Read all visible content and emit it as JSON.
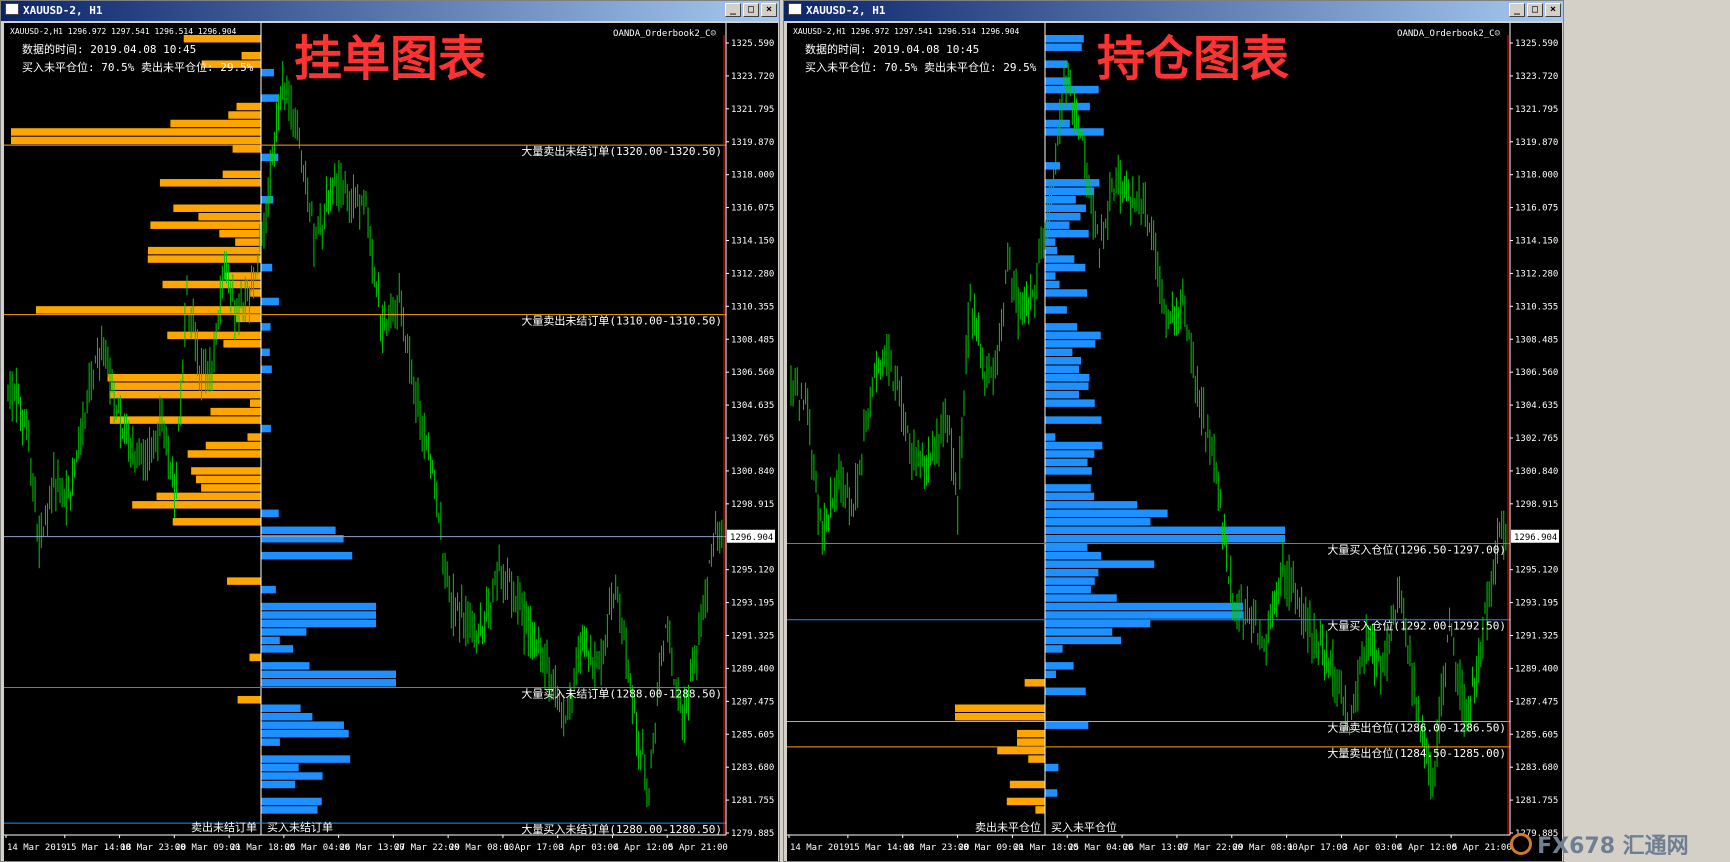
{
  "watermark": {
    "text": "FX678 汇通网"
  },
  "windows": [
    {
      "title": "XAUUSD-2, H1",
      "info": "XAUUSD-2,H1  1296.972 1297.541 1296.514 1296.904",
      "indicator": "OANDA_Orderbook2_C☺",
      "data_time": "数据的时间: 2019.04.08 10:45",
      "positions": "买入未平仓位: 70.5%  卖出未平仓位: 29.5%",
      "big_label": "挂单图表",
      "bottom_left": "卖出未结订单",
      "bottom_right": "买入未结订单",
      "current_price": "1296.904",
      "price_ticks": [
        "1325.590",
        "1323.720",
        "1321.795",
        "1319.870",
        "1318.000",
        "1316.075",
        "1314.150",
        "1312.280",
        "1310.355",
        "1308.485",
        "1306.560",
        "1304.635",
        "1302.765",
        "1300.840",
        "1298.915",
        "1296.904",
        "1295.120",
        "1293.195",
        "1291.325",
        "1289.400",
        "1287.475",
        "1285.605",
        "1283.680",
        "1281.755",
        "1279.885"
      ],
      "date_ticks": [
        "14 Mar 2019",
        "15 Mar 14:00",
        "18 Mar 23:00",
        "20 Mar 09:00",
        "21 Mar 18:00",
        "25 Mar 04:00",
        "26 Mar 13:00",
        "27 Mar 22:00",
        "29 Mar 08:00",
        "1 Apr 17:00",
        "3 Apr 03:00",
        "4 Apr 12:00",
        "5 Apr 21:00"
      ],
      "levels": [
        {
          "price": 1320.0,
          "label": "大量卖出未结订单(1320.00-1320.50)",
          "color": "#ffa500"
        },
        {
          "price": 1310.0,
          "label": "大量卖出未结订单(1310.00-1310.50)",
          "color": "#ffa500"
        },
        {
          "price": 1296.904,
          "label": "",
          "color": "#8fa3c8"
        },
        {
          "price": 1288.0,
          "label": "大量买入未结订单(1288.00-1288.50)",
          "color": "#1e90ff"
        },
        {
          "price": 1280.0,
          "label": "大量买入未结订单(1280.00-1280.50)",
          "color": "#1e90ff"
        }
      ],
      "colors": {
        "sell": "#ffa500",
        "buy": "#1e90ff",
        "candle": "#00cc00",
        "axis_red": "#ff0000",
        "title_red": "#ff3333"
      }
    },
    {
      "title": "XAUUSD-2, H1",
      "info": "XAUUSD-2,H1  1296.972 1297.541 1296.514 1296.904",
      "indicator": "OANDA_Orderbook2_C☺",
      "data_time": "数据的时间: 2019.04.08 10:45",
      "positions": "买入未平仓位: 70.5%  卖出未平仓位: 29.5%",
      "big_label": "持仓图表",
      "bottom_left": "卖出未平仓位",
      "bottom_right": "买入未平仓位",
      "current_price": "1296.904",
      "price_ticks": [
        "1325.590",
        "1323.720",
        "1321.795",
        "1319.870",
        "1318.000",
        "1316.075",
        "1314.150",
        "1312.280",
        "1310.355",
        "1308.485",
        "1306.560",
        "1304.635",
        "1302.765",
        "1300.840",
        "1298.915",
        "1296.904",
        "1295.120",
        "1293.195",
        "1291.325",
        "1289.400",
        "1287.475",
        "1285.605",
        "1283.680",
        "1281.755",
        "1279.885"
      ],
      "date_ticks": [
        "14 Mar 2019",
        "15 Mar 14:00",
        "18 Mar 23:00",
        "20 Mar 09:00",
        "21 Mar 18:00",
        "25 Mar 04:00",
        "26 Mar 13:00",
        "27 Mar 22:00",
        "29 Mar 08:00",
        "1 Apr 17:00",
        "3 Apr 03:00",
        "4 Apr 12:00",
        "5 Apr 21:00"
      ],
      "levels": [
        {
          "price": 1296.5,
          "label": "大量买入仓位(1296.50-1297.00)",
          "color": "#1e90ff"
        },
        {
          "price": 1292.0,
          "label": "大量买入仓位(1292.00-1292.50)",
          "color": "#1e90ff"
        },
        {
          "price": 1286.0,
          "label": "大量卖出仓位(1286.00-1286.50)",
          "color": "#ffa500"
        },
        {
          "price": 1284.5,
          "label": "大量卖出仓位(1284.50-1285.00)",
          "color": "#ffa500"
        }
      ],
      "colors": {
        "sell": "#ffa500",
        "buy": "#1e90ff",
        "candle": "#00cc00",
        "axis_red": "#ff0000",
        "title_red": "#ff3333"
      }
    }
  ]
}
